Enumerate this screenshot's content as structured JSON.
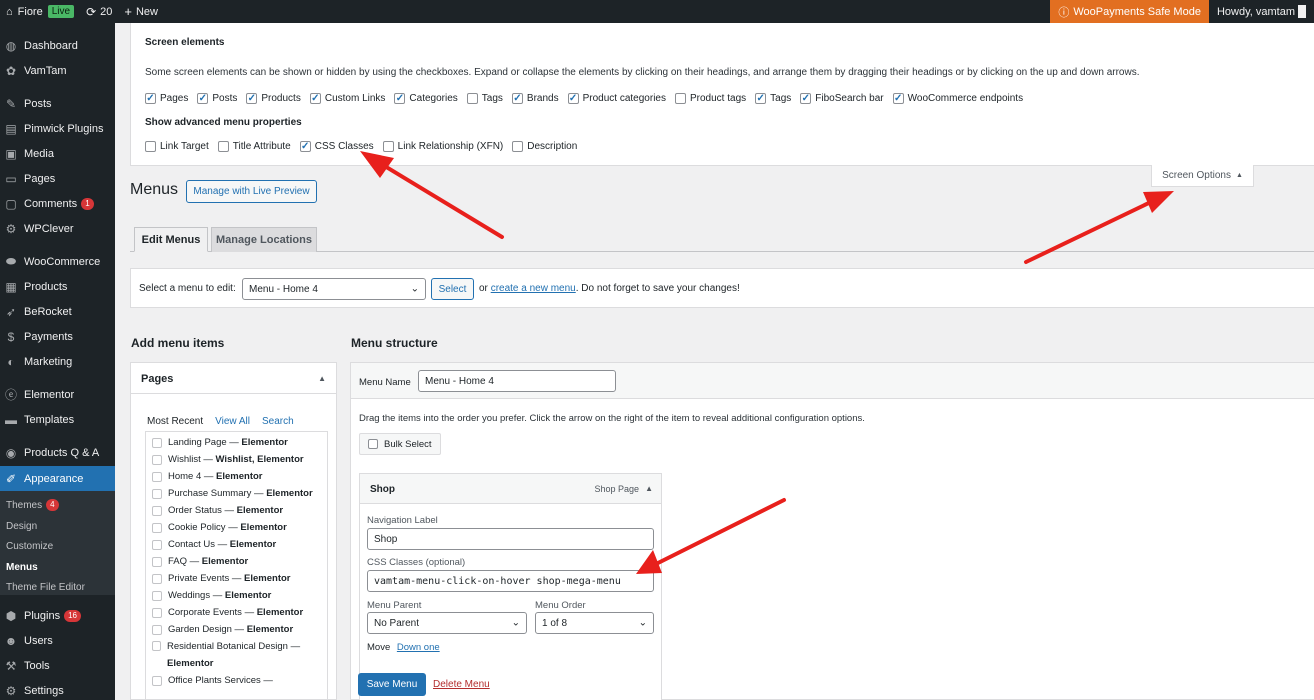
{
  "adminbar": {
    "site_name": "Fiore",
    "live_badge": "Live",
    "updates_count": "20",
    "new_label": "New",
    "woopayments": "WooPayments Safe Mode",
    "howdy": "Howdy, vamtam"
  },
  "sidebar": {
    "items": [
      {
        "label": "Dashboard",
        "icon": "dashboard-icon"
      },
      {
        "label": "VamTam",
        "icon": "vamtam-icon"
      },
      {
        "label": "Posts",
        "icon": "pin-icon"
      },
      {
        "label": "Pimwick Plugins",
        "icon": "plugin-icon"
      },
      {
        "label": "Media",
        "icon": "media-icon"
      },
      {
        "label": "Pages",
        "icon": "page-icon"
      },
      {
        "label": "Comments",
        "icon": "comment-icon",
        "badge": "1"
      },
      {
        "label": "WPClever",
        "icon": "wpclever-icon"
      },
      {
        "label": "WooCommerce",
        "icon": "woocommerce-icon"
      },
      {
        "label": "Products",
        "icon": "products-icon"
      },
      {
        "label": "BeRocket",
        "icon": "rocket-icon"
      },
      {
        "label": "Payments",
        "icon": "payments-icon"
      },
      {
        "label": "Marketing",
        "icon": "megaphone-icon"
      },
      {
        "label": "Elementor",
        "icon": "elementor-icon"
      },
      {
        "label": "Templates",
        "icon": "folder-icon"
      },
      {
        "label": "Products Q & A",
        "icon": "qa-icon"
      },
      {
        "label": "Appearance",
        "icon": "brush-icon"
      },
      {
        "label": "Plugins",
        "icon": "plugins-icon",
        "badge": "16"
      },
      {
        "label": "Users",
        "icon": "users-icon"
      },
      {
        "label": "Tools",
        "icon": "wrench-icon"
      },
      {
        "label": "Settings",
        "icon": "settings-icon"
      }
    ],
    "submenu": [
      {
        "label": "Themes",
        "badge": "4"
      },
      {
        "label": "Design"
      },
      {
        "label": "Customize"
      },
      {
        "label": "Menus"
      },
      {
        "label": "Theme File Editor"
      }
    ]
  },
  "screen_options": {
    "heading": "Screen elements",
    "description": "Some screen elements can be shown or hidden by using the checkboxes. Expand or collapse the elements by clicking on their headings, and arrange them by dragging their headings or by clicking on the up and down arrows.",
    "elements": [
      {
        "label": "Pages",
        "checked": true
      },
      {
        "label": "Posts",
        "checked": true
      },
      {
        "label": "Products",
        "checked": true
      },
      {
        "label": "Custom Links",
        "checked": true
      },
      {
        "label": "Categories",
        "checked": true
      },
      {
        "label": "Tags",
        "checked": false
      },
      {
        "label": "Brands",
        "checked": true
      },
      {
        "label": "Product categories",
        "checked": true
      },
      {
        "label": "Product tags",
        "checked": false
      },
      {
        "label": "Tags",
        "checked": true
      },
      {
        "label": "FiboSearch bar",
        "checked": true
      },
      {
        "label": "WooCommerce endpoints",
        "checked": true
      }
    ],
    "advanced_heading": "Show advanced menu properties",
    "advanced": [
      {
        "label": "Link Target",
        "checked": false
      },
      {
        "label": "Title Attribute",
        "checked": false
      },
      {
        "label": "CSS Classes",
        "checked": true
      },
      {
        "label": "Link Relationship (XFN)",
        "checked": false
      },
      {
        "label": "Description",
        "checked": false
      }
    ],
    "tab_label": "Screen Options",
    "tab_arrow": "▲"
  },
  "page": {
    "title": "Menus",
    "live_preview": "Manage with Live Preview"
  },
  "tabs": {
    "edit": "Edit Menus",
    "locations": "Manage Locations"
  },
  "manage": {
    "label": "Select a menu to edit:",
    "selected": "Menu - Home 4",
    "select_btn": "Select",
    "or": "or",
    "create_link": "create a new menu",
    "reminder": ". Do not forget to save your changes!"
  },
  "add_items": {
    "heading": "Add menu items",
    "box_title": "Pages",
    "tabs": [
      "Most Recent",
      "View All",
      "Search"
    ],
    "pages": [
      {
        "name": "Landing Page",
        "tag": "Elementor"
      },
      {
        "name": "Wishlist",
        "tag": "Wishlist, Elementor"
      },
      {
        "name": "Home 4",
        "tag": "Elementor"
      },
      {
        "name": "Purchase Summary",
        "tag": "Elementor"
      },
      {
        "name": "Order Status",
        "tag": "Elementor"
      },
      {
        "name": "Cookie Policy",
        "tag": "Elementor"
      },
      {
        "name": "Contact Us",
        "tag": "Elementor"
      },
      {
        "name": "FAQ",
        "tag": "Elementor"
      },
      {
        "name": "Private Events",
        "tag": "Elementor"
      },
      {
        "name": "Weddings",
        "tag": "Elementor"
      },
      {
        "name": "Corporate Events",
        "tag": "Elementor"
      },
      {
        "name": "Garden Design",
        "tag": "Elementor"
      },
      {
        "name": "Residential Botanical Design",
        "tag": "Elementor"
      },
      {
        "name": "Office Plants Services",
        "tag": ""
      }
    ],
    "dash": " — "
  },
  "structure": {
    "heading": "Menu structure",
    "name_label": "Menu Name",
    "name_value": "Menu - Home 4",
    "drag_hint": "Drag the items into the order you prefer. Click the arrow on the right of the item to reveal additional configuration options.",
    "bulk_select": "Bulk Select",
    "item": {
      "title": "Shop",
      "type": "Shop Page",
      "nav_label": "Navigation Label",
      "nav_value": "Shop",
      "css_label": "CSS Classes (optional)",
      "css_value": "vamtam-menu-click-on-hover shop-mega-menu",
      "parent_label": "Menu Parent",
      "parent_value": "No Parent",
      "order_label": "Menu Order",
      "order_value": "1 of 8",
      "move_label": "Move",
      "move_link": "Down one"
    },
    "save": "Save Menu",
    "delete": "Delete Menu"
  },
  "colors": {
    "accent": "#2271b1",
    "adminbar": "#1d2327",
    "woopay": "#e26f21",
    "arrow": "#e8201c",
    "danger": "#b32d2e"
  }
}
